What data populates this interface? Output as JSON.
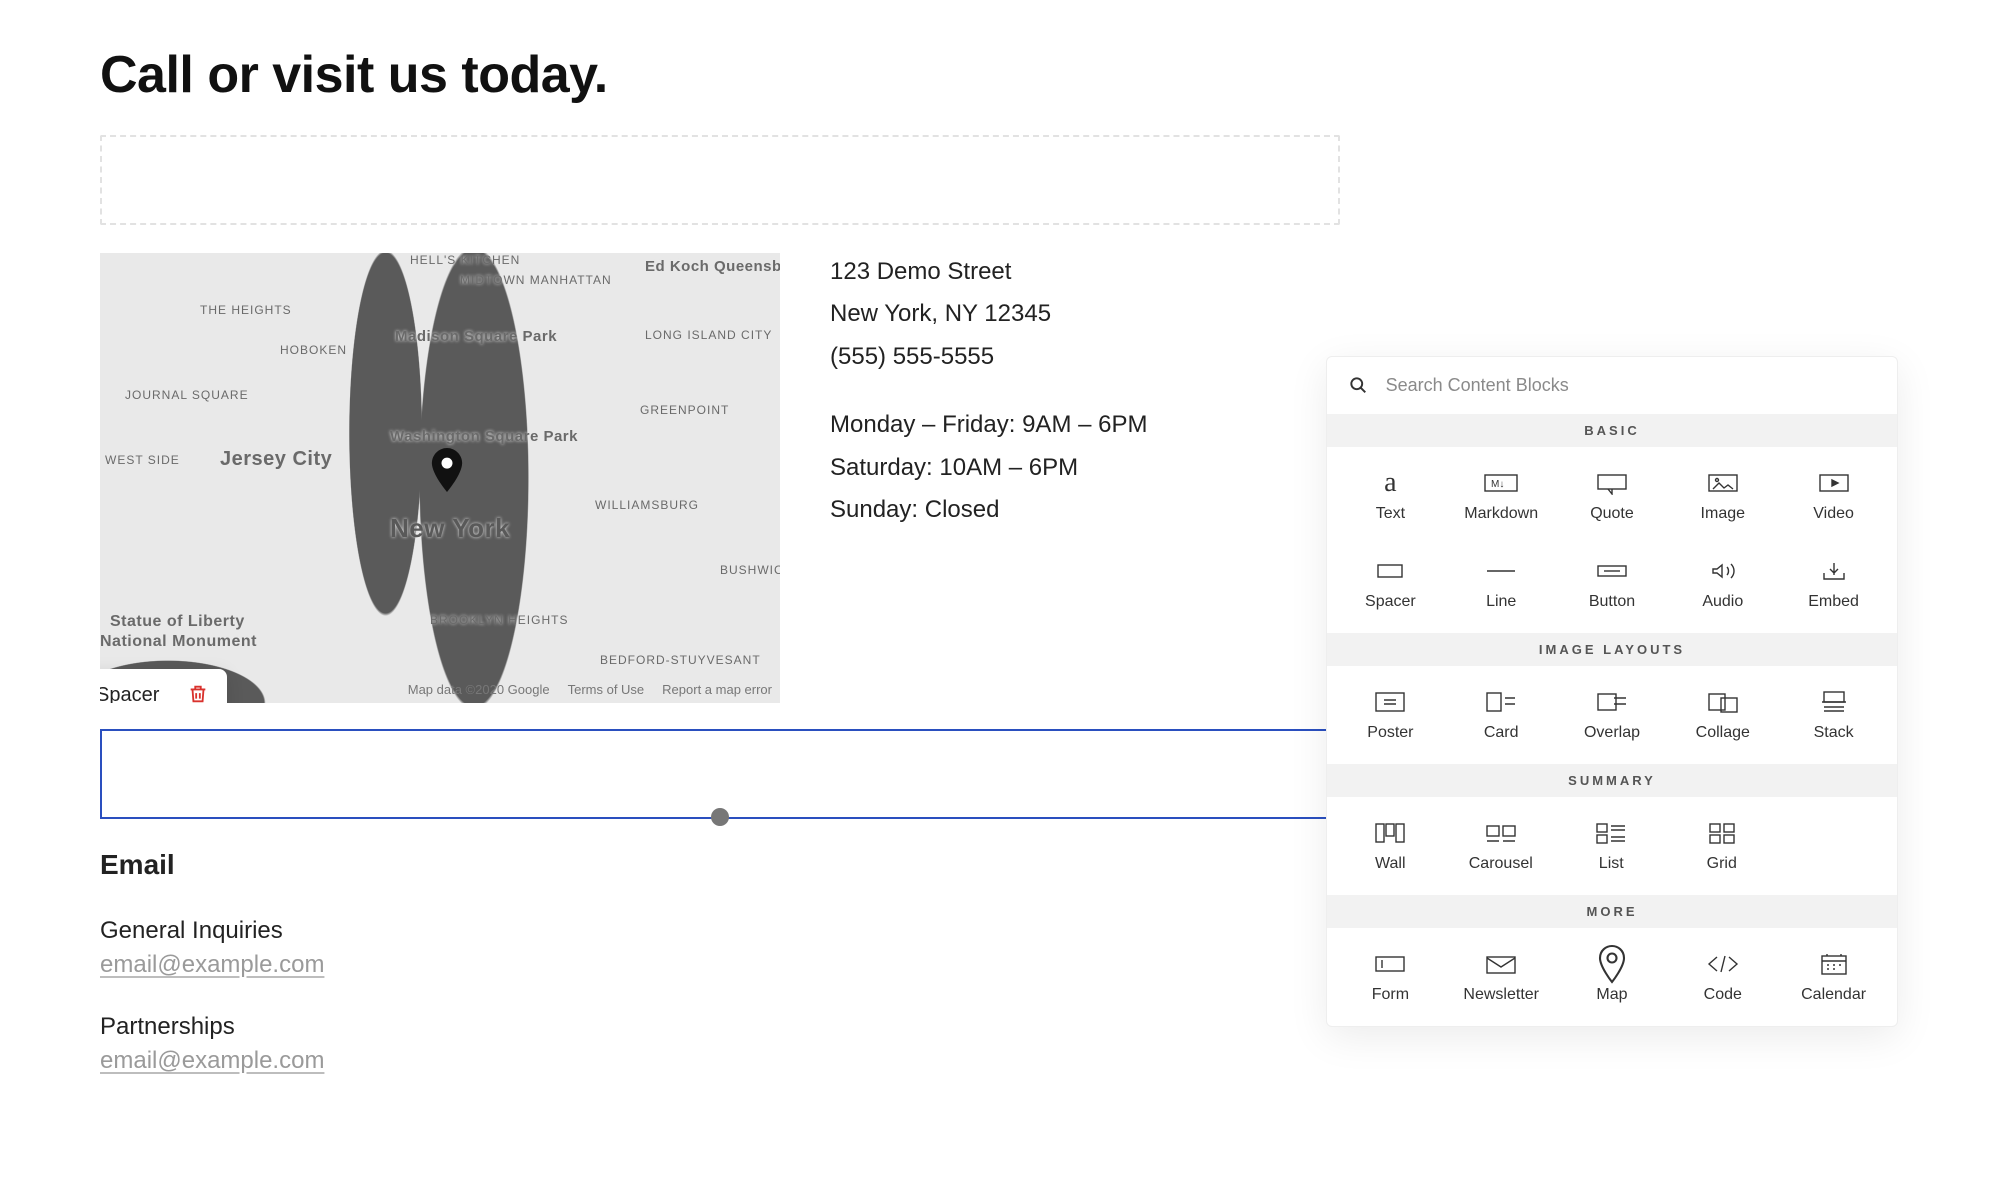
{
  "page": {
    "title": "Call or visit us today."
  },
  "map": {
    "city_label": "New York",
    "labels": {
      "jersey_city": "Jersey City",
      "hoboken": "HOBOKEN",
      "heights": "THE HEIGHTS",
      "journal_sq": "JOURNAL SQUARE",
      "statue": "Statue of Liberty",
      "statue2": "National Monument",
      "midtown": "MIDTOWN MANHATTAN",
      "kitchen": "HELL'S KITCHEN",
      "edkoch": "Ed Koch Queensboro Bridg",
      "madison": "Madison Square Park",
      "wash": "Washington Square Park",
      "long_island": "LONG ISLAND CITY",
      "greenpoint": "GREENPOINT",
      "williamsburg": "WILLIAMSBURG",
      "bushwick": "BUSHWIC",
      "bk_heights": "BROOKLYN HEIGHTS",
      "bedstuy": "BEDFORD-STUYVESANT",
      "westside": "WEST SIDE"
    },
    "attribution": {
      "data": "Map data ©2020 Google",
      "terms": "Terms of Use",
      "report": "Report a map error"
    }
  },
  "chip": {
    "label": "Spacer"
  },
  "info": {
    "line1": "123 Demo Street",
    "line2": "New York, NY 12345",
    "line3": "(555) 555-5555",
    "hours1": "Monday – Friday: 9AM – 6PM",
    "hours2": "Saturday: 10AM – 6PM",
    "hours3": "Sunday: Closed"
  },
  "email_section": {
    "heading": "Email",
    "general_label": "General Inquiries",
    "general_email": "email@example.com",
    "partnerships_label": "Partnerships",
    "partnerships_email": "email@example.com"
  },
  "panel": {
    "search_placeholder": "Search Content Blocks",
    "sections": {
      "basic": "BASIC",
      "image_layouts": "IMAGE LAYOUTS",
      "summary": "SUMMARY",
      "more": "MORE"
    },
    "blocks": {
      "text": "Text",
      "markdown": "Markdown",
      "quote": "Quote",
      "image": "Image",
      "video": "Video",
      "spacer": "Spacer",
      "line": "Line",
      "button": "Button",
      "audio": "Audio",
      "embed": "Embed",
      "poster": "Poster",
      "card": "Card",
      "overlap": "Overlap",
      "collage": "Collage",
      "stack": "Stack",
      "wall": "Wall",
      "carousel": "Carousel",
      "list": "List",
      "grid": "Grid",
      "form": "Form",
      "newsletter": "Newsletter",
      "map": "Map",
      "code": "Code",
      "calendar": "Calendar"
    }
  }
}
